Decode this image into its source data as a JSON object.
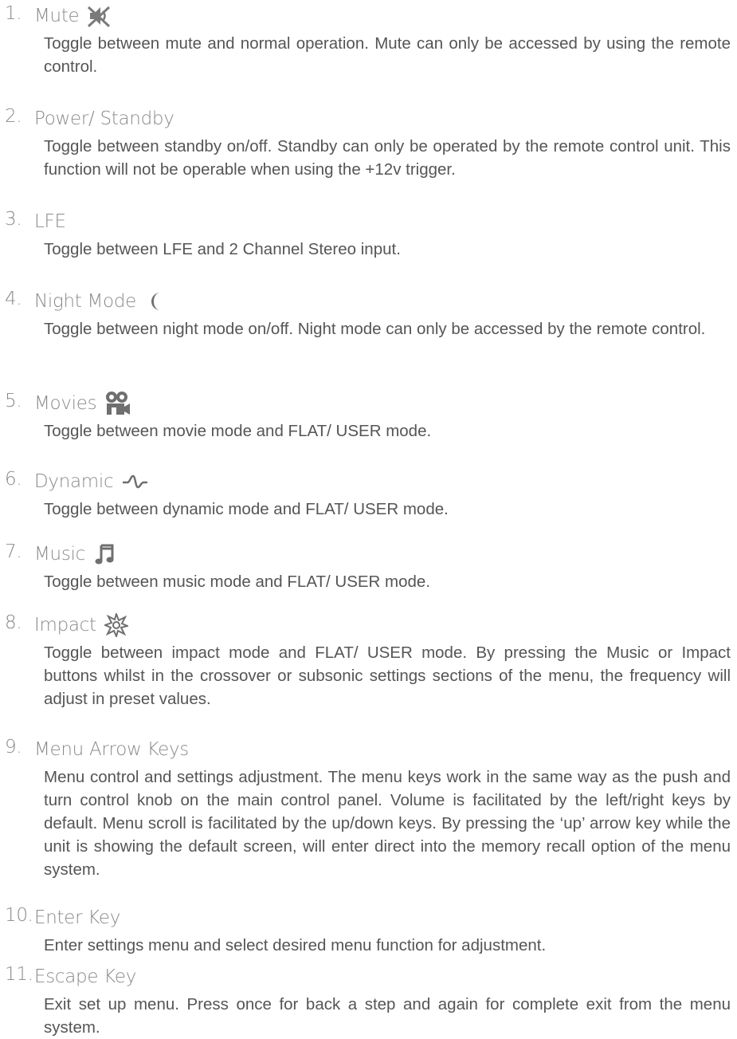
{
  "items": [
    {
      "num": "1.",
      "title": "Mute",
      "icon": "mute-icon",
      "desc": "Toggle between mute and normal operation. Mute can only be accessed by using the remote control."
    },
    {
      "num": "2.",
      "title": "Power/ Standby",
      "icon": "",
      "desc": "Toggle between standby on/off. Standby can only be operated by the remote control unit. This function will not be operable when using the +12v trigger."
    },
    {
      "num": "3.",
      "title": "LFE",
      "icon": "",
      "desc": "Toggle between LFE and 2 Channel Stereo input."
    },
    {
      "num": "4.",
      "title": "Night Mode",
      "icon": "moon-icon",
      "desc": "Toggle between night mode on/off. Night mode can only be accessed by the remote control."
    },
    {
      "num": "5.",
      "title": "Movies",
      "icon": "movie-camera-icon",
      "desc": "Toggle between movie mode and FLAT/ USER mode."
    },
    {
      "num": "6.",
      "title": "Dynamic",
      "icon": "waveform-icon",
      "desc": "Toggle between dynamic mode and FLAT/ USER mode."
    },
    {
      "num": "7.",
      "title": "Music",
      "icon": "music-note-icon",
      "desc": "Toggle between music mode and FLAT/ USER mode."
    },
    {
      "num": "8.",
      "title": "Impact",
      "icon": "starburst-icon",
      "desc": "Toggle between impact mode and FLAT/ USER mode.  By pressing the Music or Impact buttons whilst in the crossover or subsonic settings sections of the menu, the frequency will adjust in preset values."
    },
    {
      "num": "9.",
      "title": "Menu Arrow Keys",
      "icon": "",
      "desc": "Menu control and settings adjustment. The menu keys work in the same way as the push and turn control knob on the main control panel. Volume is facilitated by the left/right keys by default. Menu scroll is facilitated by the up/down keys.  By pressing the ‘up’ arrow key while the unit is showing the default screen, will enter direct into the memory recall option of the menu system."
    },
    {
      "num": "10.",
      "title": "Enter Key",
      "icon": "",
      "desc": "Enter settings menu and select desired menu function for adjustment."
    },
    {
      "num": "11.",
      "title": "Escape Key",
      "icon": "",
      "desc": "Exit set up menu. Press once for back a step and again for complete exit from the menu system."
    }
  ]
}
